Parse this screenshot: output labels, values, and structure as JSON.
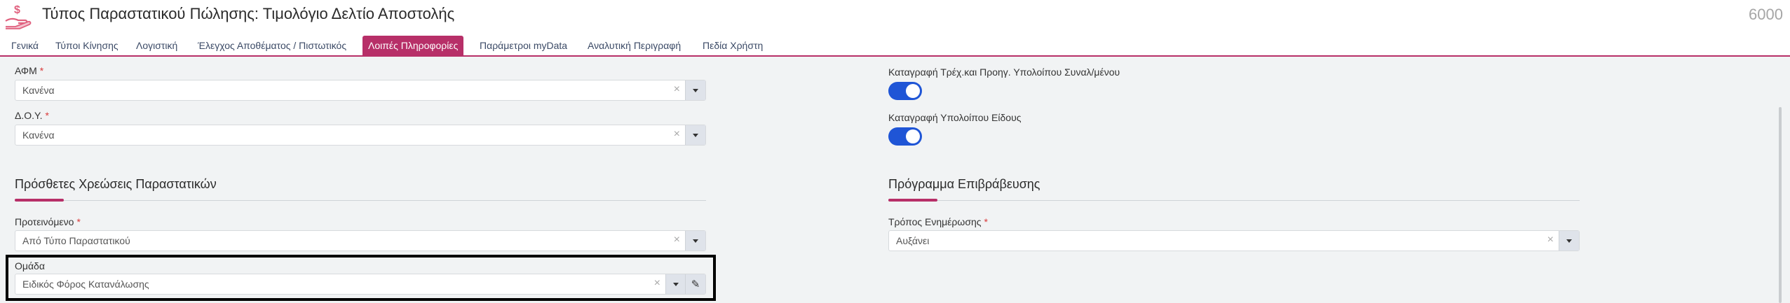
{
  "header": {
    "title": "Τύπος Παραστατικού Πώλησης: Τιμολόγιο Δελτίο Αποστολής",
    "record_id": "6000",
    "icon": "money-hand-icon",
    "icon_glyph": "$"
  },
  "tabs": [
    {
      "label": "Γενικά"
    },
    {
      "label": "Τύποι Κίνησης"
    },
    {
      "label": "Λογιστική"
    },
    {
      "label": "Έλεγχος Αποθέματος / Πιστωτικός"
    },
    {
      "label": "Λοιπές Πληροφορίες"
    },
    {
      "label": "Παράμετροι myData"
    },
    {
      "label": "Αναλυτική Περιγραφή"
    },
    {
      "label": "Πεδία Χρήστη"
    }
  ],
  "active_tab": "Λοιπές Πληροφορίες",
  "fields": {
    "afm": {
      "label": "ΑΦΜ",
      "required": "*",
      "value": "Κανένα"
    },
    "doy": {
      "label": "Δ.Ο.Υ.",
      "required": "*",
      "value": "Κανένα"
    },
    "proteinomeno": {
      "label": "Προτεινόμενο",
      "required": "*",
      "value": "Από Τύπο Παραστατικού"
    },
    "omada": {
      "label": "Ομάδα",
      "value": "Ειδικός Φόρος Κατανάλωσης"
    },
    "tropos": {
      "label": "Τρόπος Ενημέρωσης",
      "required": "*",
      "value": "Αυξάνει"
    }
  },
  "toggles": {
    "katagrafi_trex": {
      "label": "Καταγραφή Τρέχ.και Προηγ. Υπολοίπου Συναλ/μένου",
      "on": true
    },
    "katagrafi_eidous": {
      "label": "Καταγραφή Υπολοίπου Είδους",
      "on": true
    }
  },
  "sections": {
    "extra_charges": "Πρόσθετες Χρεώσεις Παραστατικών",
    "reward_program": "Πρόγραμμα Επιβράβευσης"
  },
  "glyphs": {
    "clear": "×",
    "edit": "✎"
  },
  "colors": {
    "accent": "#b72f68",
    "toggle_on": "#1f55d6",
    "icon": "#e0607e"
  }
}
